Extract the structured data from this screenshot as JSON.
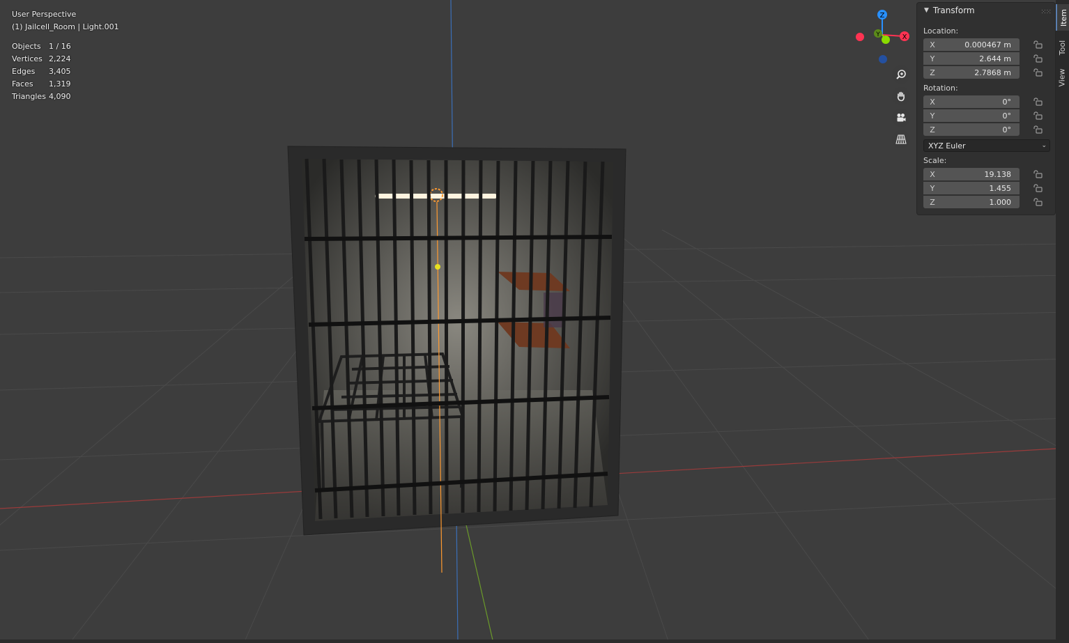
{
  "viewport": {
    "view_name": "User Perspective",
    "active_object": "(1) Jailcell_Room | Light.001",
    "stats": [
      {
        "label": "Objects",
        "value": "1 / 16"
      },
      {
        "label": "Vertices",
        "value": "2,224"
      },
      {
        "label": "Edges",
        "value": "3,405"
      },
      {
        "label": "Faces",
        "value": "1,319"
      },
      {
        "label": "Triangles",
        "value": "4,090"
      }
    ]
  },
  "gizmo": {
    "z_label": "Z",
    "y_label": "Y",
    "x_label": "X",
    "colors": {
      "x": "#ff3352",
      "y": "#8bdc00",
      "z": "#2890ff"
    }
  },
  "nav_buttons": [
    "zoom-icon",
    "hand-pan-icon",
    "camera-icon",
    "perspective-grid-icon"
  ],
  "panel": {
    "title": "Transform",
    "location_label": "Location:",
    "location": [
      {
        "axis": "X",
        "value": "0.000467 m"
      },
      {
        "axis": "Y",
        "value": "2.644 m"
      },
      {
        "axis": "Z",
        "value": "2.7868 m"
      }
    ],
    "rotation_label": "Rotation:",
    "rotation": [
      {
        "axis": "X",
        "value": "0°"
      },
      {
        "axis": "Y",
        "value": "0°"
      },
      {
        "axis": "Z",
        "value": "0°"
      }
    ],
    "rotation_mode": "XYZ Euler",
    "scale_label": "Scale:",
    "scale": [
      {
        "axis": "X",
        "value": "19.138"
      },
      {
        "axis": "Y",
        "value": "1.455"
      },
      {
        "axis": "Z",
        "value": "1.000"
      }
    ]
  },
  "tabs": [
    {
      "label": "Item",
      "active": true
    },
    {
      "label": "Tool",
      "active": false
    },
    {
      "label": "View",
      "active": false
    }
  ]
}
